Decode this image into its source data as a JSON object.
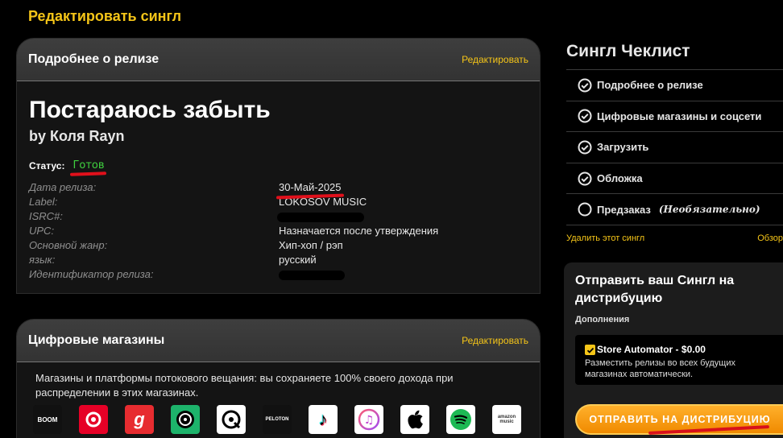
{
  "page": {
    "title": "Редактировать сингл"
  },
  "details": {
    "header": "Подробнее о релизе",
    "edit_label": "Редактировать",
    "release_title": "Постараюсь забыть",
    "artist": "by Коля Rayn",
    "status_label": "Статус:",
    "status_value": "Готов",
    "fields": [
      {
        "label": "Дата релиза:",
        "value": "30-Май-2025"
      },
      {
        "label": "Label:",
        "value": "LOKOSOV MUSIC"
      },
      {
        "label": "ISRC#:",
        "value": ""
      },
      {
        "label": "UPC:",
        "value": "Назначается после утверждения"
      },
      {
        "label": "Основной жанр:",
        "value": "Хип-хоп / рэп"
      },
      {
        "label": "язык:",
        "value": "русский"
      },
      {
        "label": "Идентификатор релиза:",
        "value": ""
      }
    ]
  },
  "stores": {
    "header": "Цифровые магазины",
    "edit_label": "Редактировать",
    "description": "Магазины и платформы потокового вещания: вы сохраняете 100% своего дохода при распределении в этих магазинах.",
    "icons": [
      {
        "name": "boom-icon",
        "text": "BOOM",
        "bg": "#111111"
      },
      {
        "name": "netease-icon",
        "text": "",
        "bg": "#e60026"
      },
      {
        "name": "gaana-icon",
        "text": "g",
        "bg": "#e72c30"
      },
      {
        "name": "jiosaavn-icon",
        "text": "",
        "bg": "#1db36b"
      },
      {
        "name": "qobuz-icon",
        "text": "",
        "bg": "#ffffff"
      },
      {
        "name": "peloton-icon",
        "text": "PELOTON",
        "bg": "#111111"
      },
      {
        "name": "tiktok-icon",
        "text": "♪",
        "bg": "#ffffff"
      },
      {
        "name": "itunes-icon",
        "text": "♫",
        "bg": "#ffffff"
      },
      {
        "name": "apple-icon",
        "text": "",
        "bg": "#ffffff"
      },
      {
        "name": "spotify-icon",
        "text": "",
        "bg": "#ffffff"
      },
      {
        "name": "amazon-music-icon",
        "text": "amazon music",
        "bg": "#ffffff"
      }
    ]
  },
  "checklist": {
    "title": "Сингл Чеклист",
    "items": [
      {
        "label": "Подробнее о релизе",
        "done": true
      },
      {
        "label": "Цифровые магазины и соцсети",
        "done": true
      },
      {
        "label": "Загрузить",
        "done": true
      },
      {
        "label": "Обложка",
        "done": true
      },
      {
        "label": "Предзаказ",
        "done": false,
        "note": "(Необязательно)"
      }
    ],
    "delete_link": "Удалить этот сингл",
    "overview_link": "Обзор"
  },
  "submit": {
    "title": "Отправить ваш Сингл на дистрибуцию",
    "addons_label": "Дополнения",
    "addon_name": "Store Automator - $0.00",
    "addon_desc": "Разместить релизы во всех будущих магазинах автоматически.",
    "button_label": "ОТПРАВИТЬ НА ДИСТРИБУЦИЮ"
  },
  "colors": {
    "accent": "#f5c518",
    "status_ok": "#3fd13f",
    "button": "#f59a0a"
  }
}
